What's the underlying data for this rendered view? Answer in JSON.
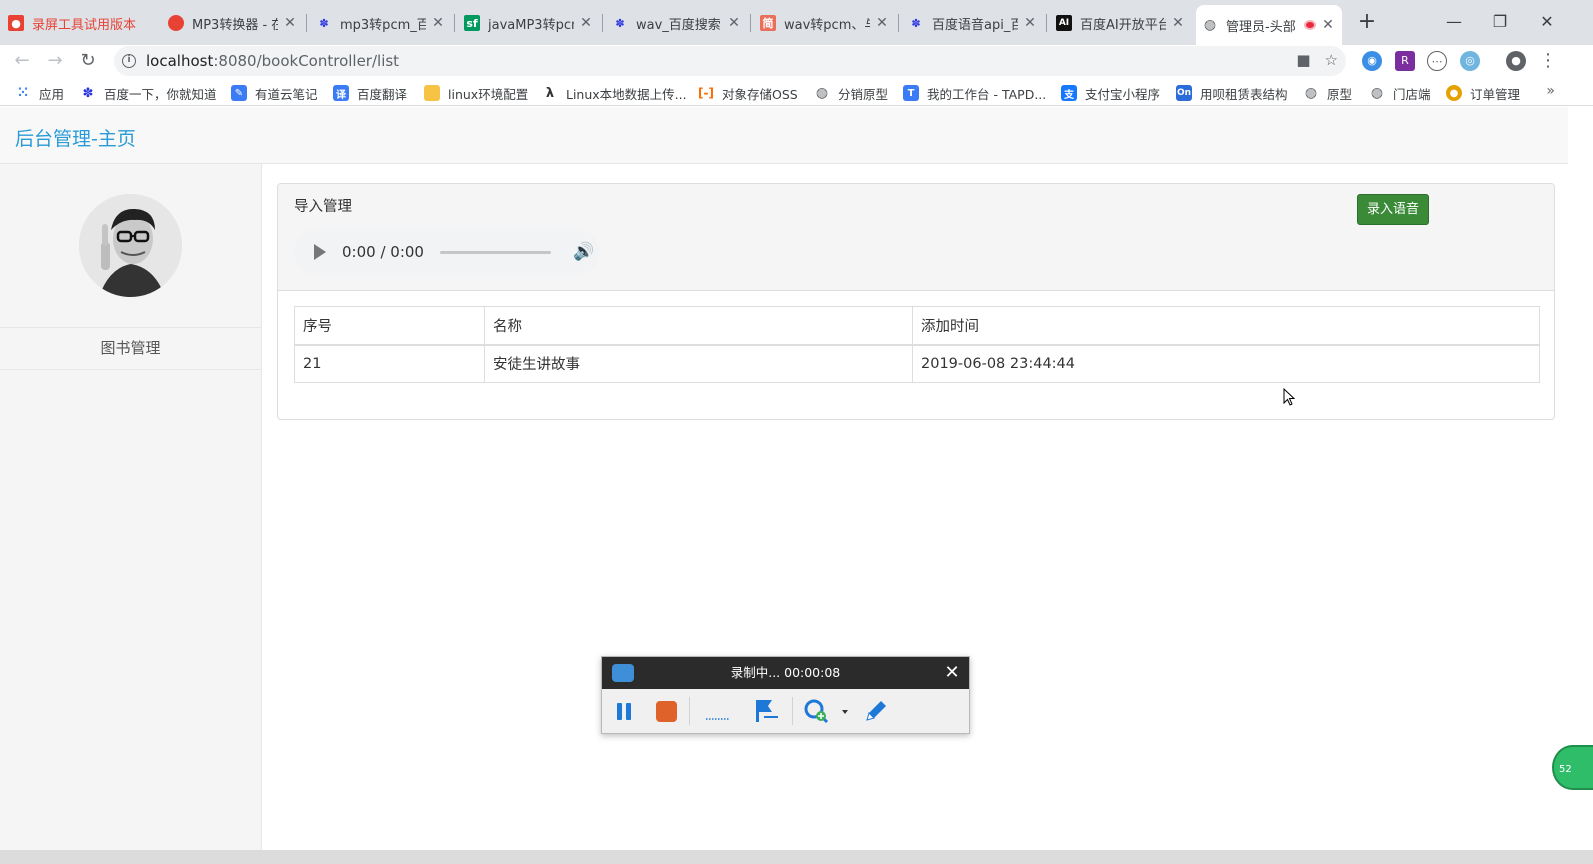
{
  "browser": {
    "tabs": [
      {
        "label": "录屏工具试用版本",
        "icon": "recorder-icon",
        "color": "#e84235",
        "faded": true
      },
      {
        "label": "MP3转换器 - 在",
        "icon": "red-circle-icon",
        "color": "#e84235"
      },
      {
        "label": "mp3转pcm_百",
        "icon": "baidu-paw-icon",
        "color": "#2932e1"
      },
      {
        "label": "javaMP3转pcm",
        "icon": "sf-icon",
        "color": "#009a61"
      },
      {
        "label": "wav_百度搜索",
        "icon": "baidu-paw-icon",
        "color": "#2932e1"
      },
      {
        "label": "wav转pcm、与",
        "icon": "jianshu-icon",
        "color": "#ea6f5a"
      },
      {
        "label": "百度语音api_百",
        "icon": "baidu-paw-icon",
        "color": "#2932e1"
      },
      {
        "label": "百度AI开放平台",
        "icon": "ai-icon",
        "color": "#111111"
      },
      {
        "label": "管理员-头部",
        "icon": "globe-icon",
        "color": "#5f6368",
        "active": true
      }
    ],
    "url_host": "localhost",
    "url_path": ":8080/bookController/list",
    "bookmarks": [
      {
        "label": "应用",
        "icon": "apps-grid-icon",
        "color": "#4285f4"
      },
      {
        "label": "百度一下，你就知道",
        "icon": "baidu-paw-icon",
        "color": "#2932e1"
      },
      {
        "label": "有道云笔记",
        "icon": "youdao-note-icon",
        "color": "#3b7bf6"
      },
      {
        "label": "百度翻译",
        "icon": "baidu-translate-icon",
        "color": "#3b7bf6"
      },
      {
        "label": "linux环境配置",
        "icon": "folder-icon",
        "color": "#f6c344"
      },
      {
        "label": "Linux本地数据上传...",
        "icon": "lambda-icon",
        "color": "#333333"
      },
      {
        "label": "对象存储OSS",
        "icon": "aliyun-icon",
        "color": "#ff6a00"
      },
      {
        "label": "分销原型",
        "icon": "globe-icon",
        "color": "#5f6368"
      },
      {
        "label": "我的工作台 - TAPD...",
        "icon": "tapd-icon",
        "color": "#3b7bf6"
      },
      {
        "label": "支付宝小程序",
        "icon": "alipay-icon",
        "color": "#1677ff"
      },
      {
        "label": "用呗租赁表结构",
        "icon": "onenote-icon",
        "color": "#2b6cd8"
      },
      {
        "label": "原型",
        "icon": "globe-icon",
        "color": "#5f6368"
      },
      {
        "label": "门店端",
        "icon": "globe-icon",
        "color": "#5f6368"
      },
      {
        "label": "订单管理",
        "icon": "order-icon",
        "color": "#e6a100"
      }
    ],
    "more": "»"
  },
  "page": {
    "brand": "后台管理-主页",
    "sidebar": {
      "items": [
        {
          "label": "图书管理"
        }
      ]
    },
    "panel": {
      "title": "导入管理",
      "record_button": "录入语音",
      "audio": {
        "time": "0:00 / 0:00"
      }
    },
    "table": {
      "headers": [
        "序号",
        "名称",
        "添加时间"
      ],
      "rows": [
        [
          "21",
          "安徒生讲故事",
          "2019-06-08 23:44:44"
        ]
      ]
    }
  },
  "recorder": {
    "title": "录制中... 00:00:08"
  },
  "colors": {
    "brand": "#2a9bd6",
    "success_button": "#3a8a38",
    "recorder_stop": "#e0622b",
    "recorder_pause": "#1e78d7"
  }
}
